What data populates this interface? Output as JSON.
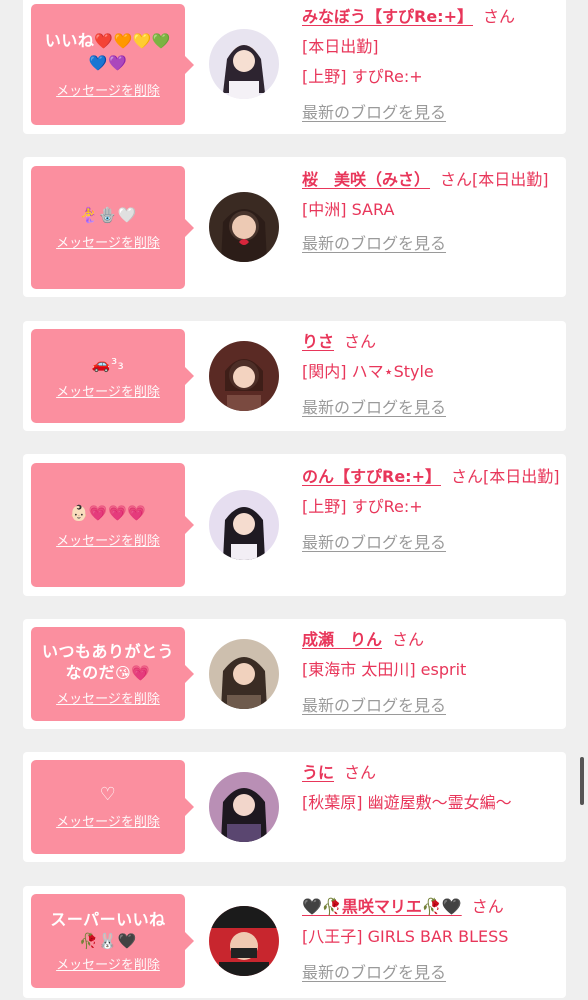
{
  "common": {
    "delete_label": "メッセージを削除",
    "san": "さん",
    "blog_label": "最新のブログを見る"
  },
  "items": [
    {
      "message": "いいね",
      "message_emoji": "❤️🧡💛💚💙💜",
      "name": "みなぼう【すぴRe:+】",
      "detail_lines": [
        "[本日出勤]",
        "[上野] すぴRe:+"
      ]
    },
    {
      "message": "",
      "message_emoji": "🧜‍♀️🪬🤍",
      "name": "桜　美咲（みさ）",
      "detail_lines": [
        "[本日出勤]",
        "[中洲] SARA"
      ]
    },
    {
      "message": "",
      "message_emoji": "🚗³₃",
      "name": "りさ",
      "detail_lines": [
        "[関内] ハマ⋆Style"
      ]
    },
    {
      "message": "",
      "message_emoji": "👶🏻💗💗💗",
      "name": "のん【すぴRe:+】",
      "detail_lines": [
        "[本日出勤]",
        "[上野] すぴRe:+"
      ]
    },
    {
      "message": "いつもありがとうなのだ",
      "message_emoji": "😘💗",
      "name": "成瀬　りん",
      "detail_lines": [
        "[東海市 太田川] esprit"
      ]
    },
    {
      "message": "",
      "message_emoji": "♡",
      "name": "うに",
      "detail_lines": [
        "[秋葉原] 幽遊屋敷～霊女編～"
      ]
    },
    {
      "message": "スーパーいいね",
      "message_emoji": "🥀🐰🖤",
      "name": "🖤🥀黒咲マリエ🥀🖤",
      "detail_lines": [
        "[八王子] GIRLS BAR BLESS"
      ]
    }
  ],
  "colors": {
    "accent": "#e8365a",
    "bubble": "#fb8f9f",
    "background": "#efefef"
  }
}
